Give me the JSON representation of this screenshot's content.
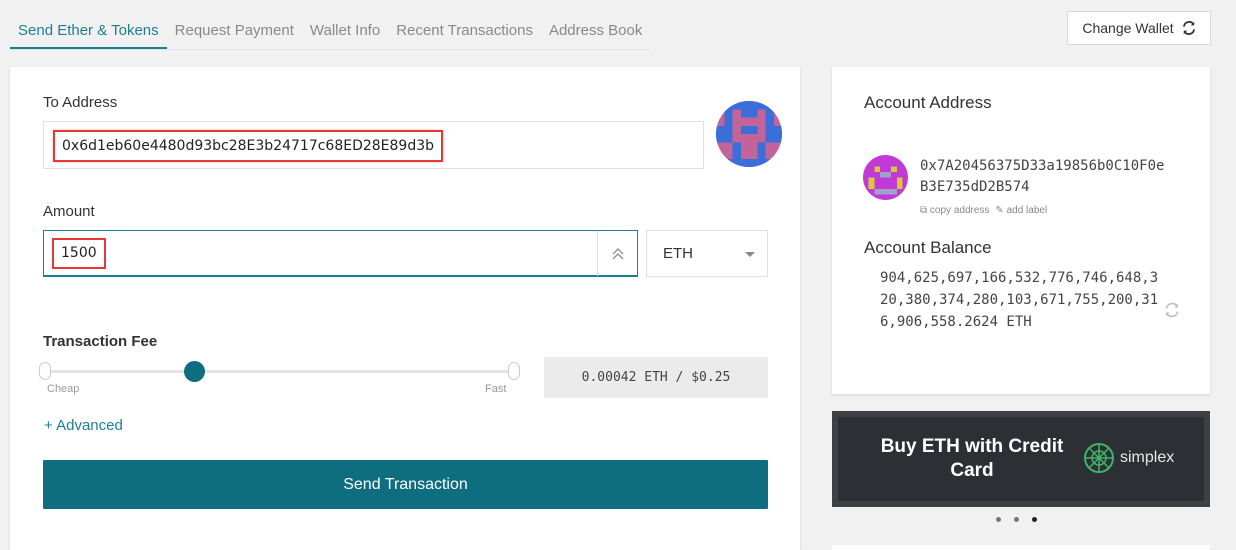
{
  "tabs": [
    {
      "label": "Send Ether & Tokens",
      "active": true
    },
    {
      "label": "Request Payment",
      "active": false
    },
    {
      "label": "Wallet Info",
      "active": false
    },
    {
      "label": "Recent Transactions",
      "active": false
    },
    {
      "label": "Address Book",
      "active": false
    }
  ],
  "change_wallet": {
    "label": "Change Wallet",
    "icon": "refresh-icon"
  },
  "send_form": {
    "to_label": "To Address",
    "to_value": "0x6d1eb60e4480d93bc28E3b24717c68ED28E89d3b",
    "amount_label": "Amount",
    "amount_value": "1500",
    "currency": "ETH",
    "fee_label": "Transaction Fee",
    "slider_cheap": "Cheap",
    "slider_fast": "Fast",
    "fee_value": "0.00042 ETH / $0.25",
    "advanced_label": "+ Advanced",
    "send_button": "Send Transaction"
  },
  "account": {
    "address_title": "Account Address",
    "address": "0x7A20456375D33a19856b0C10F0eB3E735dD2B574",
    "copy_label": "copy address",
    "add_label": "add label",
    "balance_title": "Account Balance",
    "balance": "904,625,697,166,532,776,746,648,320,380,374,280,103,671,755,200,316,906,558.2624 ETH"
  },
  "banner": {
    "text": "Buy ETH with Credit Card",
    "brand": "simplex"
  },
  "colors": {
    "accent": "#1a7f94",
    "button": "#0e6e80",
    "highlight": "#e53935"
  }
}
